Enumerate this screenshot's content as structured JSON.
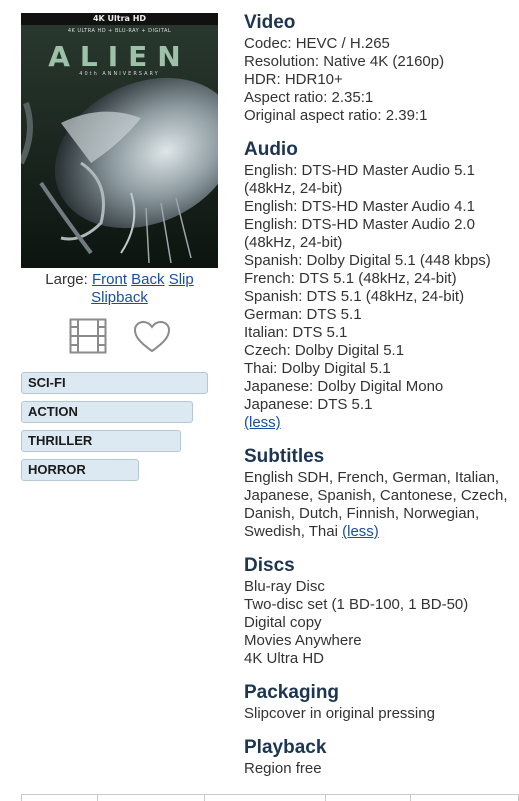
{
  "cover": {
    "band": "4K Ultra HD",
    "sub": "4K ULTRA HD + BLU-RAY + DIGITAL",
    "title": "ALIEN",
    "tag": "40th ANNIVERSARY"
  },
  "images": {
    "prefix": "Large:",
    "front": "Front",
    "back": "Back",
    "slip": "Slip",
    "slipback": "Slipback"
  },
  "icons": {
    "film": "film-icon",
    "heart": "heart-icon"
  },
  "genres": [
    "SCI-FI",
    "ACTION",
    "THRILLER",
    "HORROR"
  ],
  "video": {
    "title": "Video",
    "lines": [
      "Codec: HEVC / H.265",
      "Resolution: Native 4K (2160p)",
      "HDR: HDR10+",
      "Aspect ratio: 2.35:1",
      "Original aspect ratio: 2.39:1"
    ]
  },
  "audio": {
    "title": "Audio",
    "lines": [
      "English: DTS-HD Master Audio 5.1",
      "(48kHz, 24-bit)",
      "English: DTS-HD Master Audio 4.1",
      "English: DTS-HD Master Audio 2.0",
      "(48kHz, 24-bit)",
      "Spanish: Dolby Digital 5.1 (448 kbps)",
      "French: DTS 5.1 (48kHz, 24-bit)",
      "Spanish: DTS 5.1 (48kHz, 24-bit)",
      "German: DTS 5.1",
      "Italian: DTS 5.1",
      "Czech: Dolby Digital 5.1",
      "Thai: Dolby Digital 5.1",
      "Japanese: Dolby Digital Mono",
      "Japanese: DTS 5.1"
    ],
    "less": "(less)"
  },
  "subtitles": {
    "title": "Subtitles",
    "text": "English SDH, French, German, Italian, Japanese, Spanish, Cantonese, Czech, Danish, Dutch, Finnish, Norwegian, Swedish, Thai",
    "less": "(less)"
  },
  "discs": {
    "title": "Discs",
    "lines": [
      "Blu-ray Disc",
      "Two-disc set (1 BD-100, 1 BD-50)",
      "Digital copy",
      "Movies Anywhere",
      "4K Ultra HD"
    ]
  },
  "packaging": {
    "title": "Packaging",
    "lines": [
      "Slipcover in original pressing"
    ]
  },
  "playback": {
    "title": "Playback",
    "lines": [
      "Region free"
    ]
  }
}
